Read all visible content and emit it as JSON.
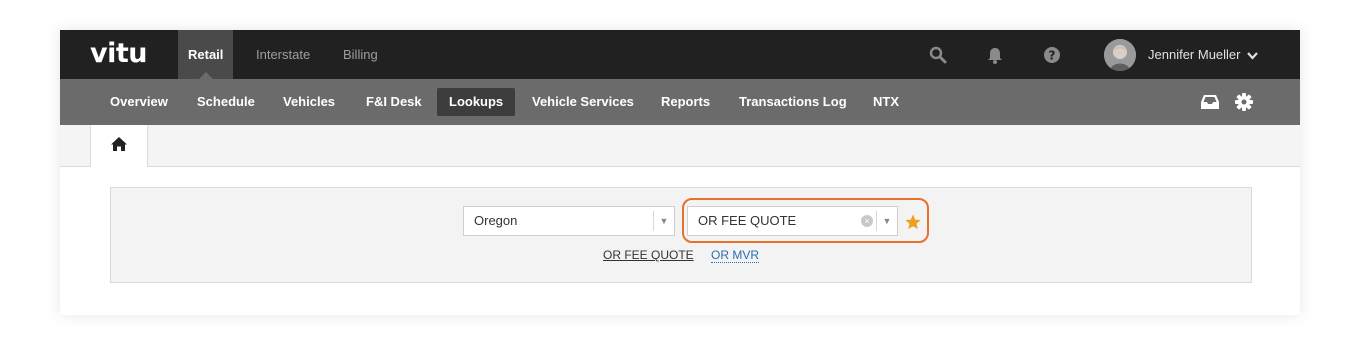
{
  "brand": {
    "logo": "vitu"
  },
  "top_tabs": [
    {
      "label": "Retail",
      "active": true
    },
    {
      "label": "Interstate",
      "active": false
    },
    {
      "label": "Billing",
      "active": false
    }
  ],
  "top_icons": [
    "search-icon",
    "bell-icon",
    "help-icon"
  ],
  "user": {
    "name": "Jennifer Mueller"
  },
  "subnav": [
    {
      "label": "Overview"
    },
    {
      "label": "Schedule"
    },
    {
      "label": "Vehicles"
    },
    {
      "label": "F&I Desk"
    },
    {
      "label": "Lookups",
      "active": true
    },
    {
      "label": "Vehicle Services"
    },
    {
      "label": "Reports"
    },
    {
      "label": "Transactions Log"
    },
    {
      "label": "NTX"
    }
  ],
  "subnav_icons": [
    "inbox-icon",
    "gear-icon"
  ],
  "home_tab": {
    "icon": "home-icon"
  },
  "lookup": {
    "state_select": {
      "value": "Oregon"
    },
    "lookup_select": {
      "value": "OR FEE QUOTE"
    },
    "favorite_icon": "star-icon",
    "favorite_color": "#f0a020",
    "recent_links": [
      {
        "label": "OR FEE QUOTE",
        "current": true
      },
      {
        "label": "OR MVR",
        "current": false
      }
    ]
  },
  "colors": {
    "highlight": "#e8702a",
    "topbar": "#212121",
    "subnav": "#6b6b6b"
  }
}
